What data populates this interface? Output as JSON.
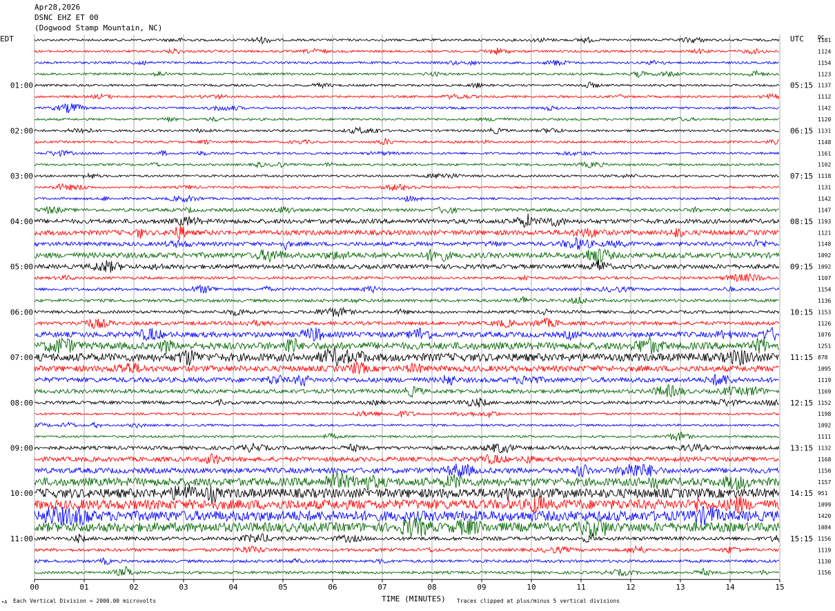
{
  "header": {
    "date": "Apr28,2026",
    "station": "DSNC EHZ ET 00",
    "location": "(Dogwood Stamp Mountain, NC)"
  },
  "labels": {
    "left_tz": "EDT",
    "right_tz": "UTC",
    "dc_header": "DC",
    "footer_left": "Each Vertical Division = 2000.00 microvolts",
    "footer_center": "Traces clipped at plus/minus 5 vertical divisions",
    "footer_mark": "∙A"
  },
  "colors": {
    "trace_cycle": [
      "#000000",
      "#ff0000",
      "#0000ff",
      "#006400"
    ],
    "grid": "#000000"
  },
  "chart_data": {
    "type": "line",
    "title": "",
    "xlabel": "TIME (MINUTES)",
    "ylabel": "",
    "xlim": [
      0,
      15
    ],
    "x_ticks": [
      "00",
      "01",
      "02",
      "03",
      "04",
      "05",
      "06",
      "07",
      "08",
      "09",
      "10",
      "11",
      "12",
      "13",
      "14",
      "15"
    ],
    "grid": true,
    "left_time_labels": [
      "01:00",
      "02:00",
      "03:00",
      "04:00",
      "05:00",
      "06:00",
      "07:00",
      "08:00",
      "09:00",
      "10:00",
      "11:00"
    ],
    "right_time_labels": [
      "05:15",
      "06:15",
      "07:15",
      "08:15",
      "09:15",
      "10:15",
      "11:15",
      "12:15",
      "13:15",
      "14:15",
      "15:15"
    ],
    "dc_offsets": [
      1181,
      1124,
      1154,
      1123,
      1137,
      1112,
      1142,
      1120,
      1131,
      1148,
      1161,
      1102,
      1118,
      1131,
      1142,
      1147,
      1193,
      1121,
      1148,
      1092,
      1092,
      1107,
      1154,
      1136,
      1153,
      1126,
      1076,
      1251,
      878,
      1095,
      1119,
      1169,
      1152,
      1198,
      1092,
      1111,
      1132,
      1168,
      1150,
      1157,
      951,
      1099,
      1420,
      1084,
      1156,
      1119,
      1130,
      1156
    ],
    "trace_activity": [
      1,
      1,
      1,
      1,
      1,
      1,
      1,
      1,
      1,
      1,
      1,
      1,
      1,
      1,
      1,
      1.4,
      2,
      2.2,
      1.8,
      2.4,
      2,
      1.2,
      1.3,
      1.3,
      1.3,
      1.6,
      2.4,
      3.2,
      3.6,
      2.6,
      2.2,
      1.8,
      1.4,
      1,
      1,
      1,
      1.6,
      2,
      2.4,
      3.6,
      4.2,
      4.4,
      4.6,
      4.2,
      1.6,
      1.4,
      1.3,
      1.2
    ]
  }
}
